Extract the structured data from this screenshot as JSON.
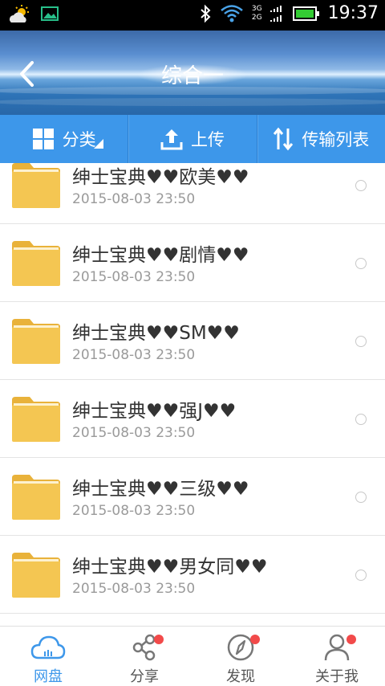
{
  "status_bar": {
    "time": "19:37",
    "net_top": "3G",
    "net_bottom": "2G",
    "icons": [
      "weather-icon",
      "image-icon",
      "bluetooth-icon",
      "wifi-icon",
      "signal-icon",
      "battery-icon"
    ]
  },
  "header": {
    "title": "综合一"
  },
  "toolbar": {
    "category_label": "分类",
    "upload_label": "上传",
    "transfer_label": "传输列表"
  },
  "folders": [
    {
      "name": "绅士宝典♥♥欧美♥♥",
      "date": "2015-08-03  23:50"
    },
    {
      "name": "绅士宝典♥♥剧情♥♥",
      "date": "2015-08-03  23:50"
    },
    {
      "name": "绅士宝典♥♥SM♥♥",
      "date": "2015-08-03  23:50"
    },
    {
      "name": "绅士宝典♥♥强J♥♥",
      "date": "2015-08-03  23:50"
    },
    {
      "name": "绅士宝典♥♥三级♥♥",
      "date": "2015-08-03  23:50"
    },
    {
      "name": "绅士宝典♥♥男女同♥♥",
      "date": "2015-08-03  23:50"
    }
  ],
  "bottom_nav": {
    "items": [
      {
        "label": "网盘",
        "icon": "cloud-icon",
        "active": true,
        "badge": false
      },
      {
        "label": "分享",
        "icon": "share-icon",
        "active": false,
        "badge": true
      },
      {
        "label": "发现",
        "icon": "compass-icon",
        "active": false,
        "badge": true
      },
      {
        "label": "关于我",
        "icon": "user-icon",
        "active": false,
        "badge": true
      }
    ]
  },
  "colors": {
    "accent": "#3d97ea",
    "folder": "#f2c44e",
    "badge": "#f24a4a"
  }
}
